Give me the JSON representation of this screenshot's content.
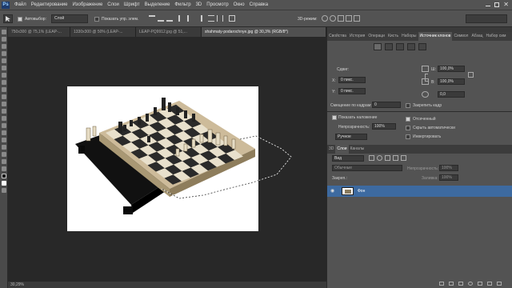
{
  "app": {
    "logo": "Ps"
  },
  "menu": [
    "Файл",
    "Редактирование",
    "Изображение",
    "Слои",
    "Шрифт",
    "Выделение",
    "Фильтр",
    "3D",
    "Просмотр",
    "Окно",
    "Справка"
  ],
  "options": {
    "autoselect_label": "Автовыбор:",
    "autoselect_value": "Слой",
    "show_controls_label": "Показать упр. элем.",
    "workspace": "3D-режим:"
  },
  "tabs": [
    "750x300 @ 75,1% (LEAP-...",
    "1330x300 @ 50% (LEAP-...",
    "LEAP-PQ9912.jpg @ 51,...",
    "shahmaty-podarochnye.jpg @ 30,3% (RGB/8*)"
  ],
  "status": "30,29%",
  "panel_tabs": [
    "Свойства",
    "История",
    "Операци",
    "Кисть",
    "Наборы",
    "Источник клонов",
    "Символ",
    "Абзац",
    "Набор сим"
  ],
  "clone": {
    "offset_label": "Сдвиг:",
    "x_label": "X:",
    "x_value": "0 пикс.",
    "y_label": "Y:",
    "y_value": "0 пикс.",
    "w_label": "Ш:",
    "w_value": "100,0%",
    "h_label": "В:",
    "h_value": "100,0%",
    "angle_value": "0,0",
    "frame_offset_label": "Смещение по кадрам:",
    "frame_offset_value": "0",
    "lock_frame_label": "Закрепить кадр",
    "show_overlay_label": "Показать наложение",
    "opacity_label": "Непрозрачность:",
    "opacity_value": "100%",
    "clipped_label": "Отсеченный",
    "autohide_label": "Скрыть автоматически",
    "invert_label": "Инвертировать",
    "mode_value": "Ручное"
  },
  "layers_panel": {
    "tabs": [
      "3D",
      "Слои",
      "Каналы"
    ],
    "kind_value": "Вид",
    "blend_value": "Обычные",
    "opacity_label": "Непрозрачность:",
    "opacity_value": "100%",
    "lock_label": "Закреп.:",
    "fill_label": "Заливка:",
    "fill_value": "100%",
    "layer_name": "Фон"
  }
}
